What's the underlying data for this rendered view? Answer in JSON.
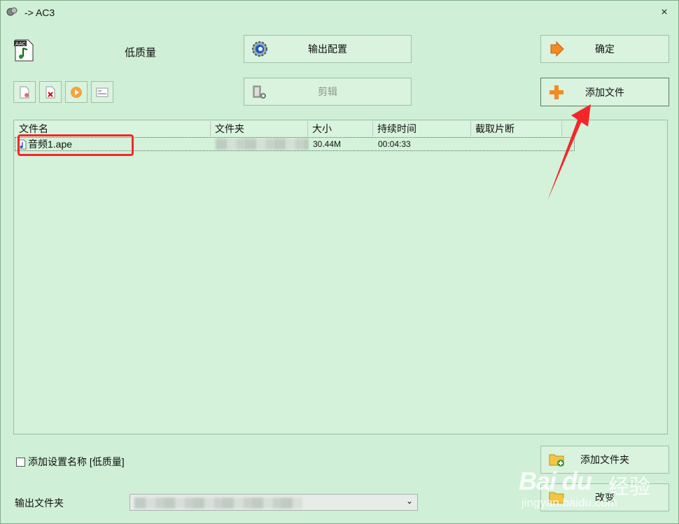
{
  "window": {
    "title": "-> AC3",
    "close_glyph": "×"
  },
  "format": {
    "icon": "aac-file-icon",
    "icon_text": "AAC",
    "quality": "低质量"
  },
  "buttons": {
    "output_config": "输出配置",
    "ok": "确定",
    "cut": "剪辑",
    "add_file": "添加文件",
    "add_folder": "添加文件夹",
    "change": "改变"
  },
  "file_table": {
    "columns": [
      "文件名",
      "文件夹",
      "大小",
      "持续时间",
      "截取片断"
    ],
    "rows": [
      {
        "name": "音频1.ape",
        "folder": "",
        "size": "30.44M",
        "duration": "00:04:33",
        "clip": ""
      }
    ]
  },
  "checkbox": {
    "label": "添加设置名称 [低质量]",
    "checked": false
  },
  "output": {
    "label": "输出文件夹",
    "value": ""
  },
  "watermark": {
    "logo": "Bai du",
    "cn": "经验",
    "url": "jingyan.baidu.com"
  },
  "colors": {
    "background": "#cfefd6",
    "highlight": "#f5262a",
    "arrow": "#f5262a",
    "plus": "#f28a22"
  }
}
